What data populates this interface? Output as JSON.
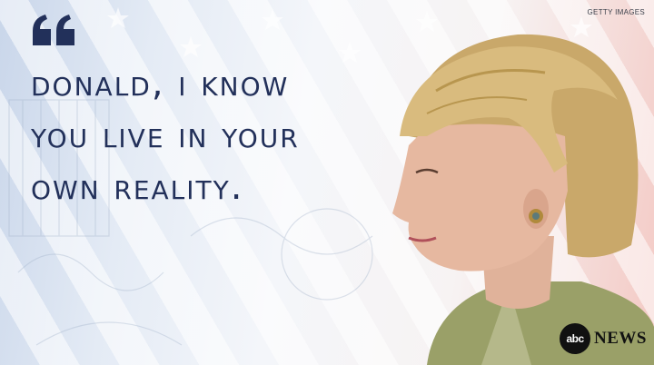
{
  "credit": "GETTY IMAGES",
  "quote": {
    "lines": [
      "Donald, I know",
      "you live in your",
      "own reality."
    ]
  },
  "logo": {
    "circle_text": "abc",
    "wordmark": "NEWS"
  },
  "colors": {
    "quote_text": "#22305a",
    "quote_mark": "#22305a",
    "blue_tint": "#c9d6ea",
    "red_tint": "#f3c9c4"
  },
  "icons": [
    "quote-mark-icon",
    "star-icon",
    "abc-logo-icon"
  ]
}
